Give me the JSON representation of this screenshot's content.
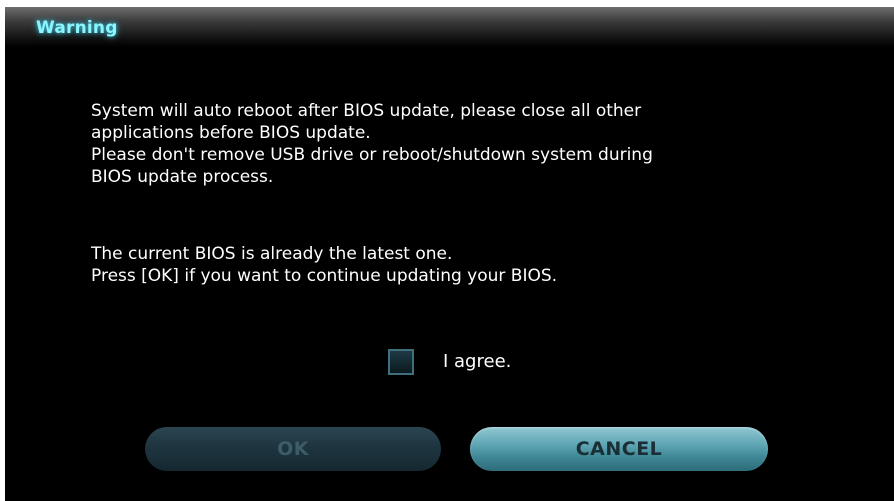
{
  "dialog": {
    "title": "Warning",
    "message_lines": [
      "System will auto reboot after BIOS update, please close all other",
      "applications before BIOS update.",
      "Please don't remove USB drive or reboot/shutdown system during",
      "BIOS update process."
    ],
    "status_lines": [
      "The current BIOS is already the latest one.",
      "Press [OK] if you want to continue updating your BIOS."
    ],
    "agree": {
      "label": "I agree.",
      "checked": false
    },
    "buttons": {
      "ok_label": "OK",
      "ok_enabled": false,
      "cancel_label": "CANCEL"
    },
    "colors": {
      "title": "#8cf6ff",
      "background": "#000000",
      "text": "#ffffff",
      "button_accent": "#5ea6b4"
    }
  }
}
